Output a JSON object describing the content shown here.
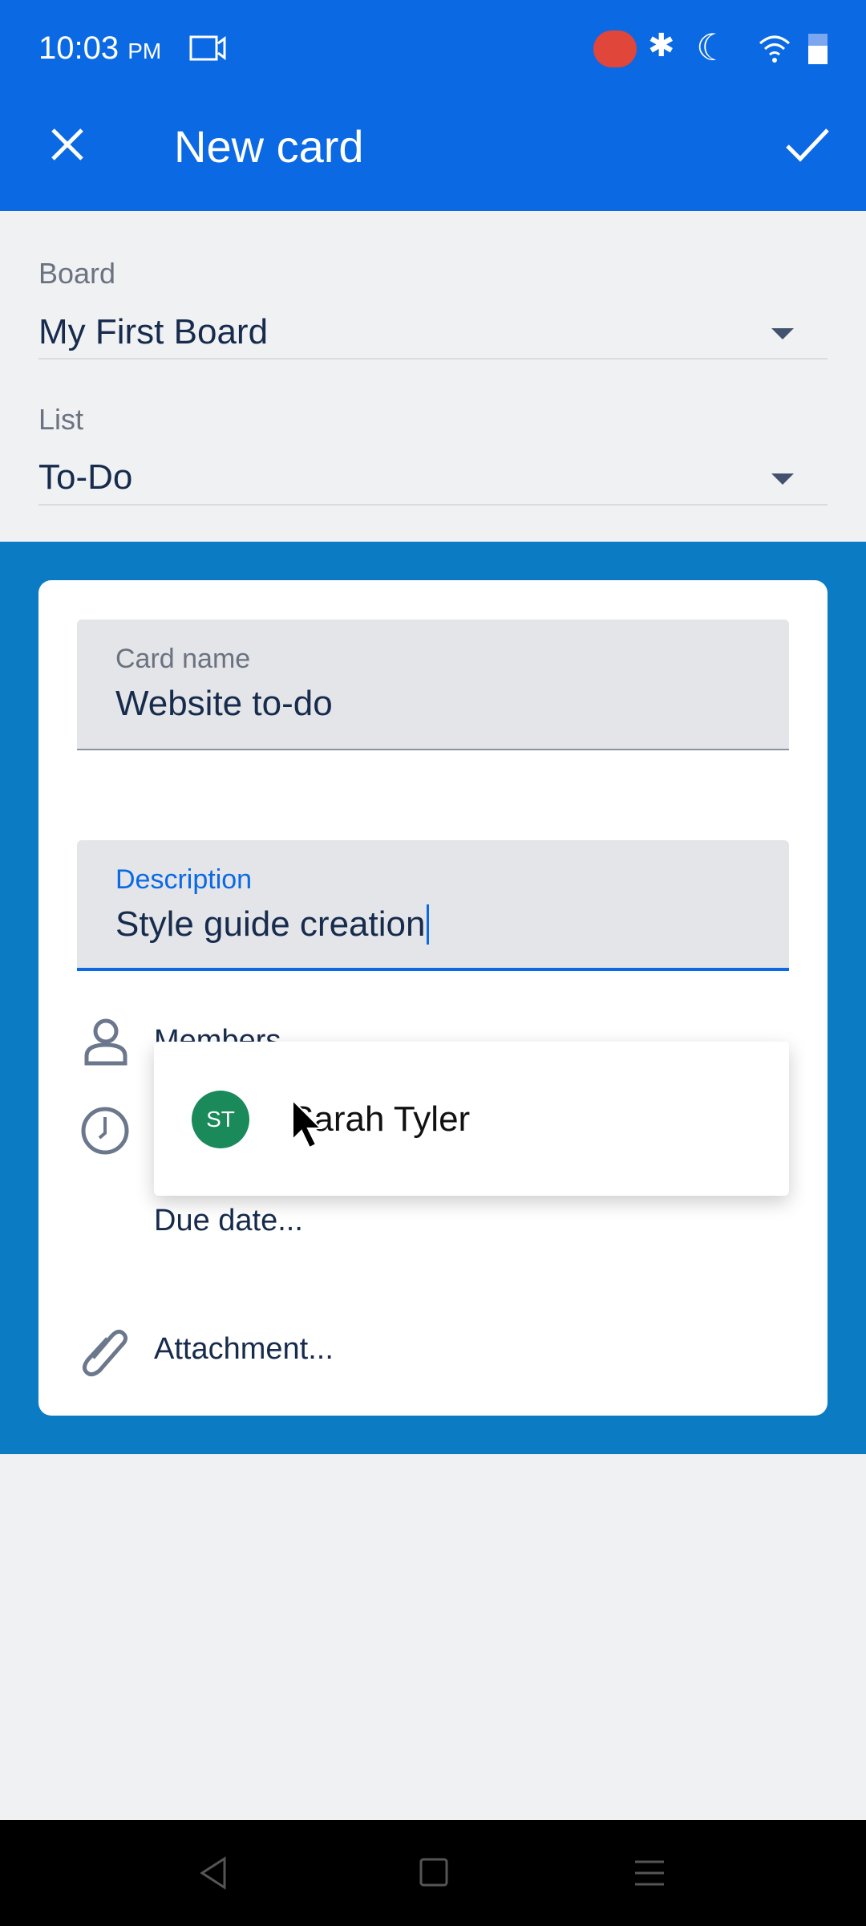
{
  "status_bar": {
    "time": "10:03",
    "ampm": "PM"
  },
  "app_bar": {
    "title": "New card",
    "close_icon": "close-icon",
    "confirm_icon": "check-icon"
  },
  "board": {
    "label": "Board",
    "value": "My First Board"
  },
  "list": {
    "label": "List",
    "value": "To-Do"
  },
  "card": {
    "name_label": "Card name",
    "name_value": "Website to-do",
    "description_label": "Description",
    "description_value": "Style guide creation",
    "members_label": "Members",
    "due_date_label": "Due date...",
    "attachment_label": "Attachment..."
  },
  "member_suggestion": {
    "initials": "ST",
    "name": "Sarah Tyler",
    "avatar_color": "#1a8a5a"
  },
  "colors": {
    "app_bar": "#0b69e3",
    "accent": "#0b7bc4",
    "focus": "#0b69e3"
  }
}
